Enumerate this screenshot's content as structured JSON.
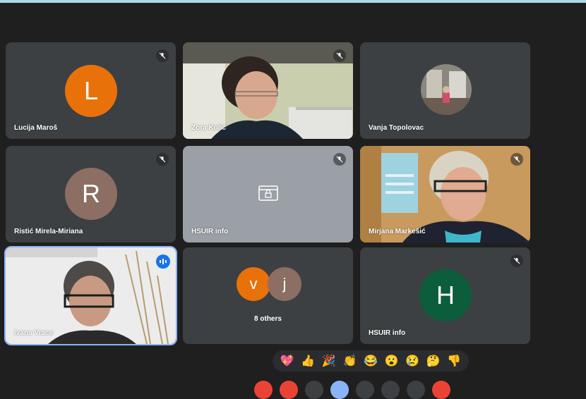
{
  "participants": {
    "lucija": {
      "name": "Lucija Maroš",
      "initial": "L",
      "color": "#e8710a"
    },
    "kolic": {
      "name": "Zora Kolić"
    },
    "vanja": {
      "name": "Vanja Topolovac"
    },
    "ristic": {
      "name": "Ristić Mirela-Miriana",
      "initial": "R",
      "color": "#8d6e63"
    },
    "hsuir1": {
      "name": "HSUIR info"
    },
    "mirjana": {
      "name": "Mirjana Markešić"
    },
    "ivana": {
      "name": "Ivana Vrace"
    },
    "others": {
      "label": "8 others",
      "initials": [
        "v",
        "j"
      ],
      "colors": [
        "#e8710a",
        "#8d6e63"
      ]
    },
    "hsuir2": {
      "name": "HSUIR info",
      "initial": "H",
      "color": "#0b5d3b"
    }
  },
  "reactions": [
    "💖",
    "👍",
    "🎉",
    "👏",
    "😂",
    "😮",
    "😢",
    "🤔",
    "👎"
  ],
  "controls": [
    "#ea4335",
    "#ea4335",
    "#3c4043",
    "#8ab4f8",
    "#3c4043",
    "#3c4043",
    "#3c4043",
    "#ea4335"
  ],
  "accent": "#8ab4f8"
}
